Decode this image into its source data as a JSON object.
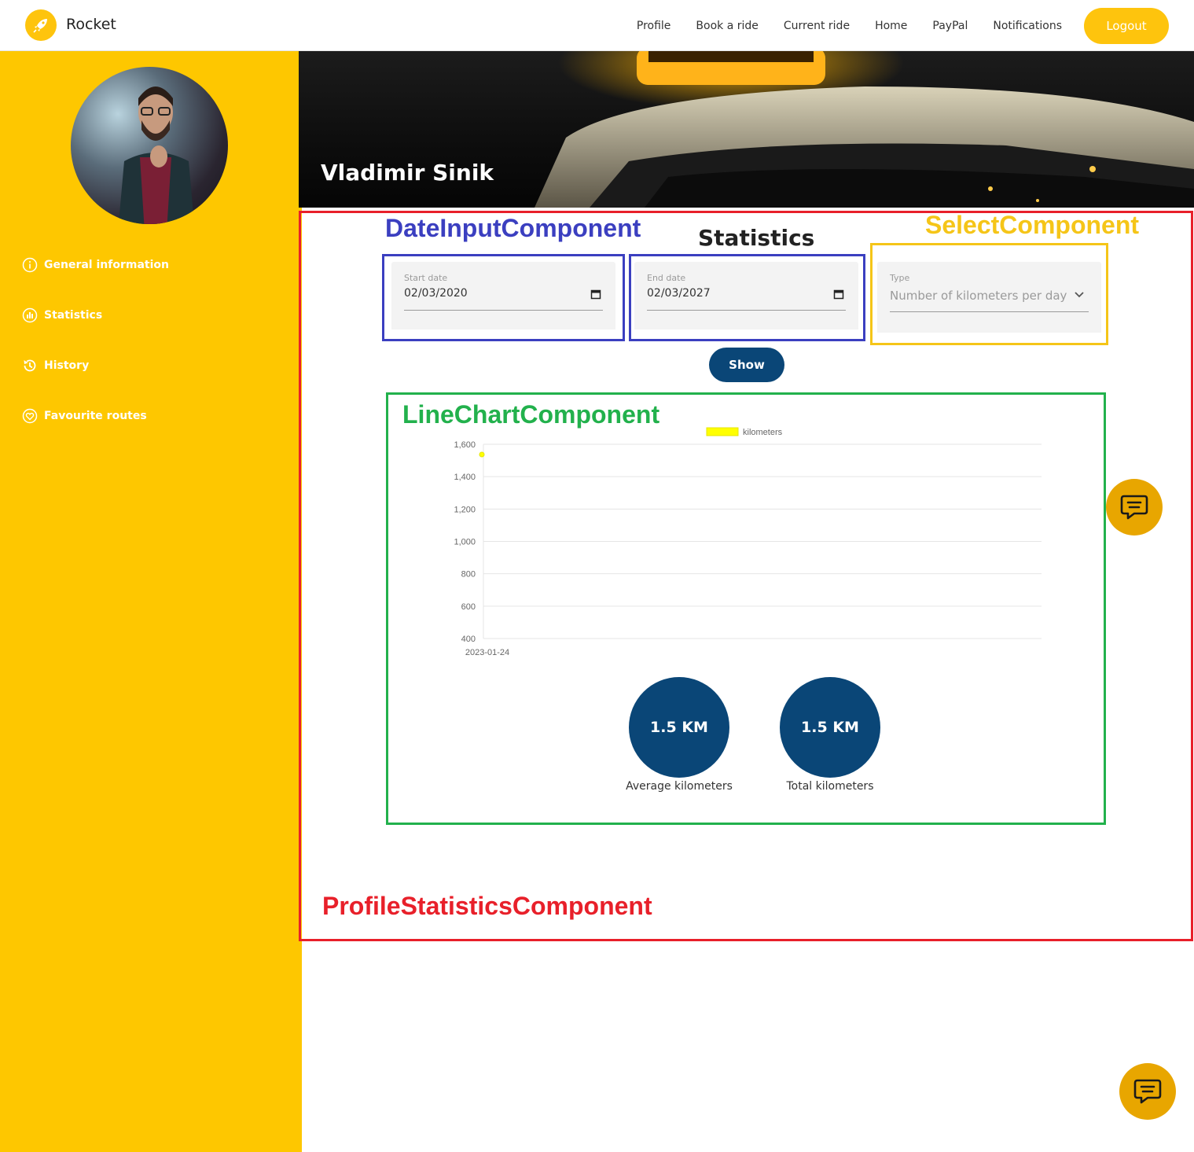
{
  "app": {
    "brand": "Rocket"
  },
  "nav": {
    "items": [
      "Profile",
      "Book a ride",
      "Current ride",
      "Home",
      "PayPal",
      "Notifications"
    ],
    "logout": "Logout"
  },
  "sidebar": {
    "items": [
      {
        "label": "General information",
        "icon": "info-icon"
      },
      {
        "label": "Statistics",
        "icon": "chart-icon"
      },
      {
        "label": "History",
        "icon": "history-icon"
      },
      {
        "label": "Favourite routes",
        "icon": "heart-icon"
      }
    ]
  },
  "banner": {
    "name": "Vladimir Sinik"
  },
  "annotations": {
    "date_input": "DateInputComponent",
    "select": "SelectComponent",
    "line_chart": "LineChartComponent",
    "profile_statistics": "ProfileStatisticsComponent"
  },
  "statistics": {
    "title": "Statistics",
    "start_date": {
      "label": "Start date",
      "value": "02/03/2020"
    },
    "end_date": {
      "label": "End date",
      "value": "02/03/2027"
    },
    "type": {
      "label": "Type",
      "value": "Number of kilometers per day"
    },
    "show": "Show",
    "average": {
      "value": "1.5 KM",
      "label": "Average kilometers"
    },
    "total": {
      "value": "1.5 KM",
      "label": "Total kilometers"
    }
  },
  "colors": {
    "accent": "#fec700",
    "navy": "#0a4677",
    "ann_red": "#e8202a",
    "ann_blue": "#3b3fc0",
    "ann_yellow": "#f5c518",
    "ann_green": "#22b14c"
  },
  "chart_data": {
    "type": "line",
    "series": [
      {
        "name": "kilometers",
        "color": "#ffff00",
        "x": [
          "2023-01-24"
        ],
        "values": [
          1.5
        ]
      }
    ],
    "categories": [
      "2023-01-24"
    ],
    "ylim": [
      400,
      1600
    ],
    "yticks": [
      "1,600",
      "1,400",
      "1,200",
      "1,000",
      "800",
      "600",
      "400"
    ],
    "legend": "top",
    "grid": true
  }
}
